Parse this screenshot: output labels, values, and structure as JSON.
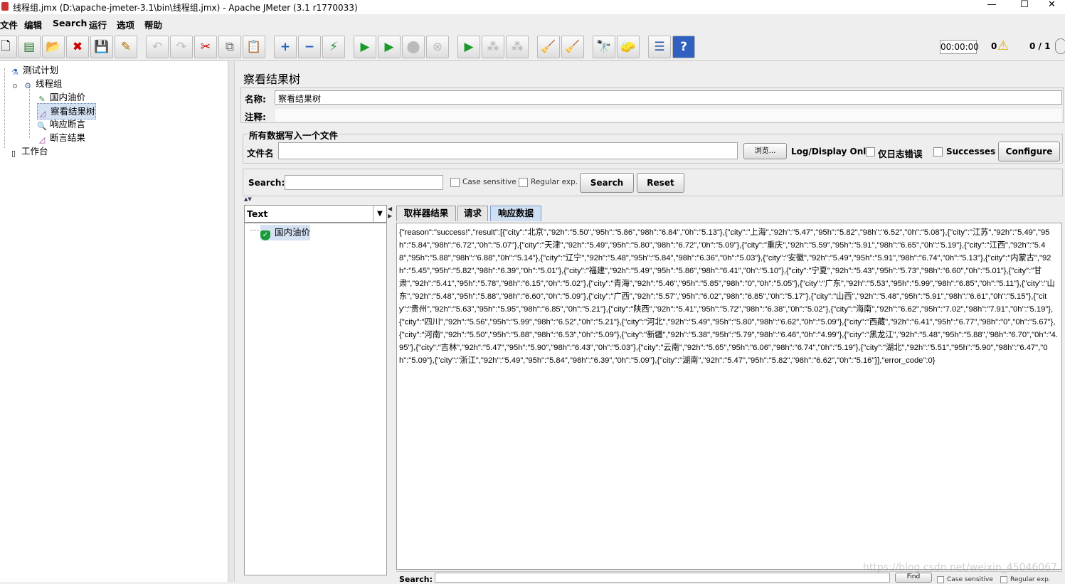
{
  "window": {
    "title": "线程组.jmx (D:\\apache-jmeter-3.1\\bin\\线程组.jmx) - Apache JMeter (3.1 r1770033)",
    "minimize": "—",
    "maximize": "☐",
    "close": "✕"
  },
  "menu": [
    "文件",
    "编辑",
    "Search",
    "运行",
    "选项",
    "帮助"
  ],
  "toolbar": {
    "timer": "00:00:00",
    "warn_count": "0",
    "threads": "0 / 1"
  },
  "tree": [
    {
      "label": "测试计划",
      "icon": "flask-icon"
    },
    {
      "label": "线程组",
      "icon": "gear-icon"
    },
    {
      "label": "国内油价",
      "icon": "pipette-icon"
    },
    {
      "label": "察看结果树",
      "icon": "chart-icon"
    },
    {
      "label": "响应断言",
      "icon": "magnifier-icon"
    },
    {
      "label": "断言结果",
      "icon": "chart-icon"
    },
    {
      "label": "工作台",
      "icon": "workbench-icon"
    }
  ],
  "panel": {
    "heading": "察看结果树",
    "name_label": "名称:",
    "name_value": "察看结果树",
    "comment_label": "注释:",
    "file_group": "所有数据写入一个文件",
    "filename_label": "文件名",
    "browse": "浏览...",
    "log_display": "Log/Display Only:",
    "errors_only": "仅日志错误",
    "successes": "Successes",
    "configure": "Configure"
  },
  "search": {
    "label": "Search:",
    "case": "Case sensitive",
    "regex": "Regular exp.",
    "search_btn": "Search",
    "reset_btn": "Reset",
    "bottom_label": "Search:",
    "find_btn": "Find",
    "bottom_case": "Case sensitive",
    "bottom_regex": "Regular exp."
  },
  "results": {
    "renderer": "Text",
    "sample": "国内油价",
    "tabs": [
      "取样器结果",
      "请求",
      "响应数据"
    ],
    "response": "{\"reason\":\"success!\",\"result\":[{\"city\":\"北京\",\"92h\":\"5.50\",\"95h\":\"5.86\",\"98h\":\"6.84\",\"0h\":\"5.13\"},{\"city\":\"上海\",\"92h\":\"5.47\",\"95h\":\"5.82\",\"98h\":\"6.52\",\"0h\":\"5.08\"},{\"city\":\"江苏\",\"92h\":\"5.49\",\"95h\":\"5.84\",\"98h\":\"6.72\",\"0h\":\"5.07\"},{\"city\":\"天津\",\"92h\":\"5.49\",\"95h\":\"5.80\",\"98h\":\"6.72\",\"0h\":\"5.09\"},{\"city\":\"重庆\",\"92h\":\"5.59\",\"95h\":\"5.91\",\"98h\":\"6.65\",\"0h\":\"5.19\"},{\"city\":\"江西\",\"92h\":\"5.48\",\"95h\":\"5.88\",\"98h\":\"6.88\",\"0h\":\"5.14\"},{\"city\":\"辽宁\",\"92h\":\"5.48\",\"95h\":\"5.84\",\"98h\":\"6.36\",\"0h\":\"5.03\"},{\"city\":\"安徽\",\"92h\":\"5.49\",\"95h\":\"5.91\",\"98h\":\"6.74\",\"0h\":\"5.13\"},{\"city\":\"内蒙古\",\"92h\":\"5.45\",\"95h\":\"5.82\",\"98h\":\"6.39\",\"0h\":\"5.01\"},{\"city\":\"福建\",\"92h\":\"5.49\",\"95h\":\"5.86\",\"98h\":\"6.41\",\"0h\":\"5.10\"},{\"city\":\"宁夏\",\"92h\":\"5.43\",\"95h\":\"5.73\",\"98h\":\"6.60\",\"0h\":\"5.01\"},{\"city\":\"甘肃\",\"92h\":\"5.41\",\"95h\":\"5.78\",\"98h\":\"6.15\",\"0h\":\"5.02\"},{\"city\":\"青海\",\"92h\":\"5.46\",\"95h\":\"5.85\",\"98h\":\"0\",\"0h\":\"5.05\"},{\"city\":\"广东\",\"92h\":\"5.53\",\"95h\":\"5.99\",\"98h\":\"6.85\",\"0h\":\"5.11\"},{\"city\":\"山东\",\"92h\":\"5.48\",\"95h\":\"5.88\",\"98h\":\"6.60\",\"0h\":\"5.09\"},{\"city\":\"广西\",\"92h\":\"5.57\",\"95h\":\"6.02\",\"98h\":\"6.85\",\"0h\":\"5.17\"},{\"city\":\"山西\",\"92h\":\"5.48\",\"95h\":\"5.91\",\"98h\":\"6.61\",\"0h\":\"5.15\"},{\"city\":\"贵州\",\"92h\":\"5.63\",\"95h\":\"5.95\",\"98h\":\"6.85\",\"0h\":\"5.21\"},{\"city\":\"陕西\",\"92h\":\"5.41\",\"95h\":\"5.72\",\"98h\":\"6.38\",\"0h\":\"5.02\"},{\"city\":\"海南\",\"92h\":\"6.62\",\"95h\":\"7.02\",\"98h\":\"7.91\",\"0h\":\"5.19\"},{\"city\":\"四川\",\"92h\":\"5.56\",\"95h\":\"5.99\",\"98h\":\"6.52\",\"0h\":\"5.21\"},{\"city\":\"河北\",\"92h\":\"5.49\",\"95h\":\"5.80\",\"98h\":\"6.62\",\"0h\":\"5.09\"},{\"city\":\"西藏\",\"92h\":\"6.41\",\"95h\":\"6.77\",\"98h\":\"0\",\"0h\":\"5.67\"},{\"city\":\"河南\",\"92h\":\"5.50\",\"95h\":\"5.88\",\"98h\":\"6.53\",\"0h\":\"5.09\"},{\"city\":\"新疆\",\"92h\":\"5.38\",\"95h\":\"5.79\",\"98h\":\"6.46\",\"0h\":\"4.99\"},{\"city\":\"黑龙江\",\"92h\":\"5.48\",\"95h\":\"5.88\",\"98h\":\"6.70\",\"0h\":\"4.95\"},{\"city\":\"吉林\",\"92h\":\"5.47\",\"95h\":\"5.90\",\"98h\":\"6.43\",\"0h\":\"5.03\"},{\"city\":\"云南\",\"92h\":\"5.65\",\"95h\":\"6.06\",\"98h\":\"6.74\",\"0h\":\"5.19\"},{\"city\":\"湖北\",\"92h\":\"5.51\",\"95h\":\"5.90\",\"98h\":\"6.47\",\"0h\":\"5.09\"},{\"city\":\"浙江\",\"92h\":\"5.49\",\"95h\":\"5.84\",\"98h\":\"6.39\",\"0h\":\"5.09\"},{\"city\":\"湖南\",\"92h\":\"5.47\",\"95h\":\"5.82\",\"98h\":\"6.62\",\"0h\":\"5.16\"}],\"error_code\":0}"
  },
  "watermark": "https://blog.csdn.net/weixin_45046067"
}
